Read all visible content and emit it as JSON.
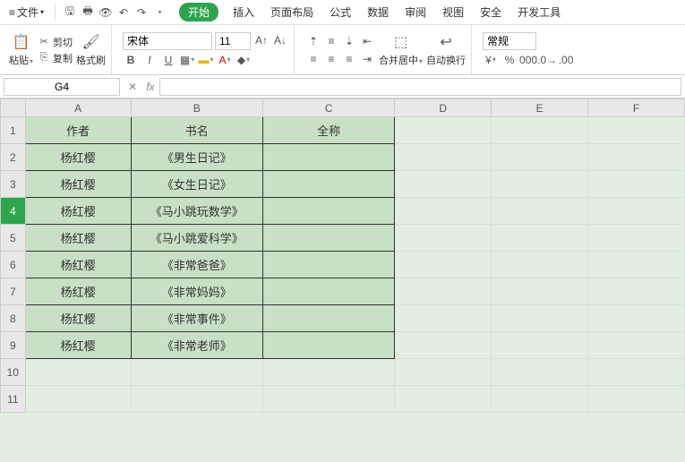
{
  "menubar": {
    "file_label": "文件",
    "tabs": [
      "开始",
      "插入",
      "页面布局",
      "公式",
      "数据",
      "审阅",
      "视图",
      "安全",
      "开发工具"
    ],
    "active_tab_index": 0
  },
  "ribbon": {
    "clipboard": {
      "paste": "粘贴",
      "cut": "剪切",
      "copy": "复制",
      "format_painter": "格式刷"
    },
    "font": {
      "name": "宋体",
      "size": "11"
    },
    "merge": "合并居中",
    "wrap": "自动换行",
    "number_format": "常规"
  },
  "fbar": {
    "namebox": "G4",
    "formula": ""
  },
  "sheet": {
    "columns": [
      "A",
      "B",
      "C",
      "D",
      "E",
      "F"
    ],
    "rows": [
      1,
      2,
      3,
      4,
      5,
      6,
      7,
      8,
      9,
      10,
      11
    ],
    "active_row": 4,
    "bordered_rows": 9,
    "bordered_cols": 3,
    "data": [
      [
        "作者",
        "书名",
        "全称"
      ],
      [
        "杨红樱",
        "《男生日记》",
        ""
      ],
      [
        "杨红樱",
        "《女生日记》",
        ""
      ],
      [
        "杨红樱",
        "《马小跳玩数学》",
        ""
      ],
      [
        "杨红樱",
        "《马小跳爱科学》",
        ""
      ],
      [
        "杨红樱",
        "《非常爸爸》",
        ""
      ],
      [
        "杨红樱",
        "《非常妈妈》",
        ""
      ],
      [
        "杨红樱",
        "《非常事件》",
        ""
      ],
      [
        "杨红樱",
        "《非常老师》",
        ""
      ],
      [
        "",
        "",
        ""
      ],
      [
        "",
        "",
        ""
      ]
    ]
  }
}
